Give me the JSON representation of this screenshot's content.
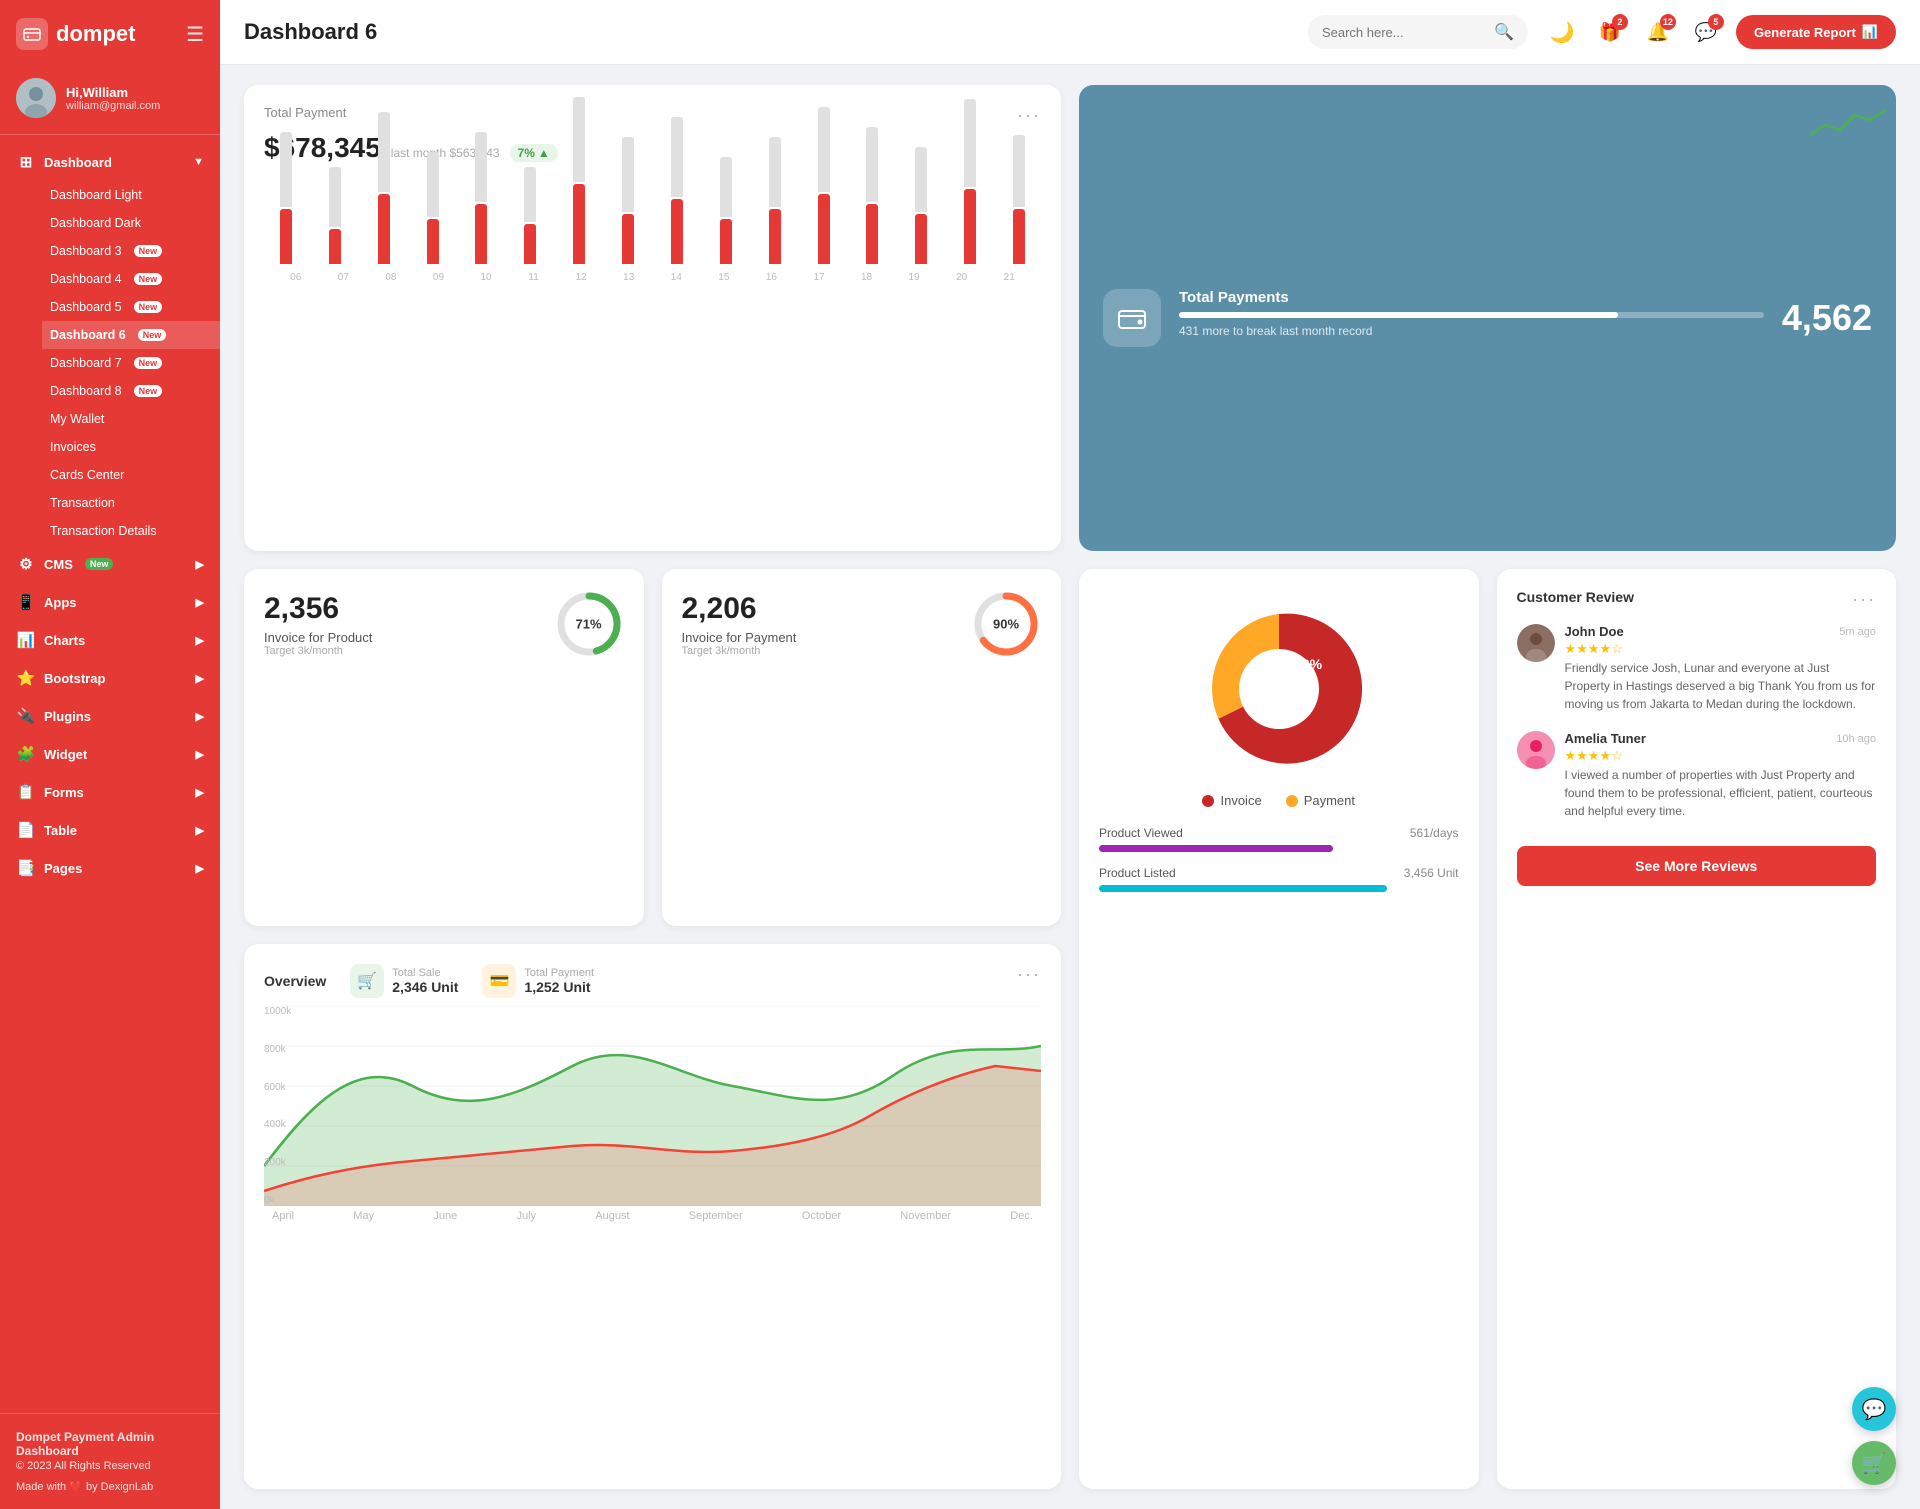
{
  "app": {
    "logo": "dompet",
    "logo_icon": "💳"
  },
  "sidebar": {
    "user": {
      "greeting": "Hi,William",
      "email": "william@gmail.com"
    },
    "dashboard_label": "Dashboard",
    "items": [
      {
        "label": "Dashboard Light",
        "new": false
      },
      {
        "label": "Dashboard Dark",
        "new": false
      },
      {
        "label": "Dashboard 3",
        "new": true
      },
      {
        "label": "Dashboard 4",
        "new": true
      },
      {
        "label": "Dashboard 5",
        "new": true
      },
      {
        "label": "Dashboard 6",
        "new": true,
        "active": true
      },
      {
        "label": "Dashboard 7",
        "new": true
      },
      {
        "label": "Dashboard 8",
        "new": true
      },
      {
        "label": "My Wallet",
        "new": false
      },
      {
        "label": "Invoices",
        "new": false
      },
      {
        "label": "Cards Center",
        "new": false
      },
      {
        "label": "Transaction",
        "new": false
      },
      {
        "label": "Transaction Details",
        "new": false
      }
    ],
    "sections": [
      {
        "label": "CMS",
        "new": true,
        "icon": "⚙️"
      },
      {
        "label": "Apps",
        "new": false,
        "icon": "📱"
      },
      {
        "label": "Charts",
        "new": false,
        "icon": "📊"
      },
      {
        "label": "Bootstrap",
        "new": false,
        "icon": "⭐"
      },
      {
        "label": "Plugins",
        "new": false,
        "icon": "🔌"
      },
      {
        "label": "Widget",
        "new": false,
        "icon": "🧩"
      },
      {
        "label": "Forms",
        "new": false,
        "icon": "📋"
      },
      {
        "label": "Table",
        "new": false,
        "icon": "📄"
      },
      {
        "label": "Pages",
        "new": false,
        "icon": "📑"
      }
    ],
    "footer": {
      "title": "Dompet Payment Admin Dashboard",
      "copy": "© 2023 All Rights Reserved",
      "made": "Made with ❤️ by DexignLab"
    }
  },
  "topbar": {
    "title": "Dashboard 6",
    "search_placeholder": "Search here...",
    "generate_btn": "Generate Report",
    "badges": {
      "notifications1": "2",
      "notifications2": "12",
      "messages": "5"
    }
  },
  "total_payment": {
    "title": "Total Payment",
    "amount": "$678,345",
    "last_month": "last month $563,443",
    "trend": "7%",
    "dots": "...",
    "bars": [
      {
        "red": 55,
        "gray": 75
      },
      {
        "red": 35,
        "gray": 60
      },
      {
        "red": 70,
        "gray": 80
      },
      {
        "red": 45,
        "gray": 65
      },
      {
        "red": 60,
        "gray": 70
      },
      {
        "red": 40,
        "gray": 55
      },
      {
        "red": 80,
        "gray": 85
      },
      {
        "red": 50,
        "gray": 75
      },
      {
        "red": 65,
        "gray": 80
      },
      {
        "red": 45,
        "gray": 60
      },
      {
        "red": 55,
        "gray": 70
      },
      {
        "red": 70,
        "gray": 85
      },
      {
        "red": 60,
        "gray": 75
      },
      {
        "red": 50,
        "gray": 65
      },
      {
        "red": 75,
        "gray": 88
      },
      {
        "red": 55,
        "gray": 72
      }
    ],
    "bar_labels": [
      "06",
      "07",
      "08",
      "09",
      "10",
      "11",
      "12",
      "13",
      "14",
      "15",
      "16",
      "17",
      "18",
      "19",
      "20",
      "21"
    ]
  },
  "total_payments_blue": {
    "title": "Total Payments",
    "sub": "431 more to break last month record",
    "count": "4,562",
    "bar_pct": 75,
    "icon": "👛"
  },
  "invoice_product": {
    "number": "2,356",
    "label": "Invoice for Product",
    "target": "Target 3k/month",
    "pct": "71%",
    "pct_num": 71,
    "color": "#4caf50"
  },
  "invoice_payment": {
    "number": "2,206",
    "label": "Invoice for Payment",
    "target": "Target 3k/month",
    "pct": "90%",
    "pct_num": 90,
    "color": "#ff7043"
  },
  "pie_chart": {
    "invoice_pct": "62%",
    "payment_pct": "38%",
    "invoice_color": "#c62828",
    "payment_color": "#ffa726",
    "legend_invoice": "Invoice",
    "legend_payment": "Payment"
  },
  "product_stats": {
    "viewed_label": "Product Viewed",
    "viewed_value": "561/days",
    "viewed_color": "#9c27b0",
    "viewed_pct": 65,
    "listed_label": "Product Listed",
    "listed_value": "3,456 Unit",
    "listed_color": "#00bcd4",
    "listed_pct": 80
  },
  "overview": {
    "title": "Overview",
    "dots": "...",
    "total_sale_label": "Total Sale",
    "total_sale_value": "2,346 Unit",
    "total_sale_icon": "🛒",
    "total_sale_icon_bg": "#e8f5e9",
    "total_payment_label": "Total Payment",
    "total_payment_value": "1,252 Unit",
    "total_payment_icon": "💳",
    "total_payment_icon_bg": "#fff3e0",
    "x_labels": [
      "April",
      "May",
      "June",
      "July",
      "August",
      "September",
      "October",
      "November",
      "Dec."
    ],
    "y_labels": [
      "1000k",
      "800k",
      "600k",
      "400k",
      "200k",
      "0k"
    ]
  },
  "customer_review": {
    "title": "Customer Review",
    "dots": "...",
    "reviews": [
      {
        "name": "John Doe",
        "time": "5m ago",
        "stars": 4,
        "text": "Friendly service Josh, Lunar and everyone at Just Property in Hastings deserved a big Thank You from us for moving us from Jakarta to Medan during the lockdown."
      },
      {
        "name": "Amelia Tuner",
        "time": "10h ago",
        "stars": 4,
        "text": "I viewed a number of properties with Just Property and found them to be professional, efficient, patient, courteous and helpful every time."
      }
    ],
    "see_more_btn": "See More Reviews"
  },
  "colors": {
    "primary": "#e53935",
    "sidebar_bg": "#e53935",
    "blue_card": "#5b8fa8",
    "green": "#4caf50",
    "orange": "#ff7043"
  }
}
